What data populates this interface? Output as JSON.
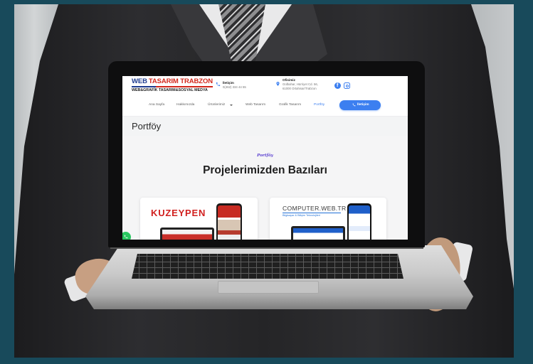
{
  "colors": {
    "frame": "#184a5b",
    "logo_blue": "#1d3b8f",
    "logo_red": "#d3281c",
    "accent_blue": "#3c7ff0",
    "kicker_purple": "#5a3fd0",
    "kuzeypen_red": "#d1201f",
    "whatsapp_green": "#28c660"
  },
  "website": {
    "logo": {
      "part1": "WEB",
      "part2": "TASARIM TRABZON",
      "tagline": "WEB&GRAFİK TASARIM&SOSYAL MEDYA"
    },
    "contact": {
      "icon": "phone-icon",
      "label": "İletişim",
      "value": "0(462) 334 44 55"
    },
    "office": {
      "icon": "location-pin-icon",
      "label": "Ofisimiz",
      "address_line1": "Gülbahar, Hürriyet Cd. 56,",
      "address_line2": "61000 Ortahisar/Trabzon"
    },
    "social": [
      "facebook-icon",
      "instagram-icon"
    ],
    "nav": {
      "items": [
        "Ana Sayfa",
        "Hakkımızda",
        "Ürünlerimiz",
        "Web Tasarım",
        "Grafik Tasarım",
        "Portföy"
      ],
      "dropdown_icon": "caret-down-icon",
      "active_index": 5,
      "cta": {
        "icon": "phone-icon",
        "label": "İletişim"
      }
    },
    "page_title": "Portföy",
    "section": {
      "kicker": "Portföy",
      "heading": "Projelerimizden Bazıları"
    },
    "projects": [
      {
        "brand": "KUZEYPEN"
      },
      {
        "brand": "COMPUTER.WEB.TR",
        "tagline": "Bilgisayar & Bilişim Teknolojileri"
      }
    ],
    "floating_icon": "whatsapp-icon"
  }
}
